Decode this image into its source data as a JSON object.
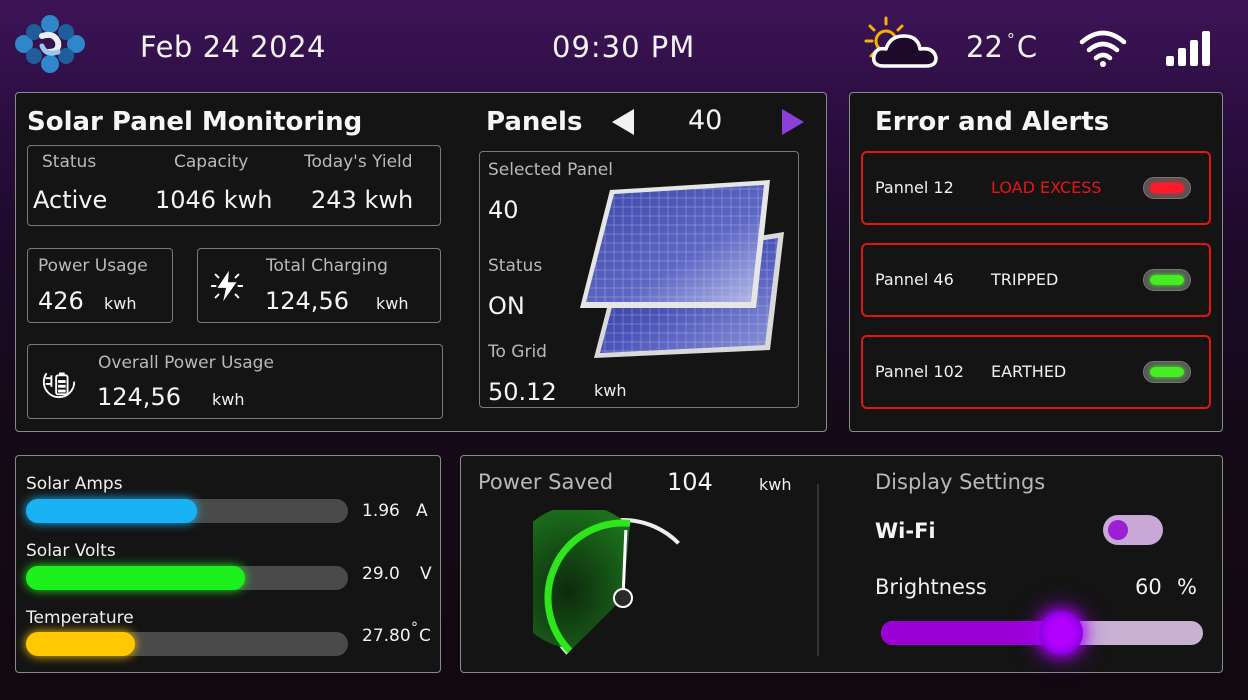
{
  "header": {
    "date": "Feb 24 2024",
    "time": "09:30  PM",
    "temperature": "22",
    "temperature_unit": "C",
    "icons": [
      "logo-icon",
      "partly-sunny-icon",
      "wifi-icon",
      "signal-icon"
    ]
  },
  "monitoring": {
    "title": "Solar Panel Monitoring",
    "status_label": "Status",
    "status_value": "Active",
    "capacity_label": "Capacity",
    "capacity_value": "1046 kwh",
    "yield_label": "Today's Yield",
    "yield_value": "243 kwh",
    "power_usage_label": "Power Usage",
    "power_usage_value": "426",
    "power_usage_unit": "kwh",
    "total_charging_label": "Total Charging",
    "total_charging_value": "124,56",
    "total_charging_unit": "kwh",
    "overall_label": "Overall Power Usage",
    "overall_value": "124,56",
    "overall_unit": "kwh"
  },
  "panels": {
    "title": "Panels",
    "count": "40",
    "selected_label": "Selected Panel",
    "selected_value": "40",
    "status_label": "Status",
    "status_value": "ON",
    "grid_label": "To Grid",
    "grid_value": "50.12",
    "grid_unit": "kwh"
  },
  "alerts": {
    "title": "Error and Alerts",
    "items": [
      {
        "name": "Pannel 12",
        "message": "LOAD EXCESS",
        "status_color": "#ff1a2a"
      },
      {
        "name": "Pannel 46",
        "message": "TRIPPED",
        "status_color": "#44ee22"
      },
      {
        "name": "Pannel 102",
        "message": "EARTHED",
        "status_color": "#44ee22"
      }
    ]
  },
  "meters": [
    {
      "label": "Solar Amps",
      "value": "1.96",
      "unit": "A",
      "fraction": 0.53,
      "color": "#19b3f5"
    },
    {
      "label": "Solar Volts",
      "value": "29.0",
      "unit": "V",
      "fraction": 0.68,
      "color": "#1ef01e"
    },
    {
      "label": "Temperature",
      "value": "27.80",
      "unit": "C",
      "fraction": 0.34,
      "color": "#ffc800"
    }
  ],
  "power_saved": {
    "label": "Power Saved",
    "value": "104",
    "unit": "kwh",
    "gauge_fraction": 0.86
  },
  "display_settings": {
    "title": "Display Settings",
    "wifi_label": "Wi-Fi",
    "wifi_on": true,
    "brightness_label": "Brightness",
    "brightness_value": "60",
    "brightness_unit": "%",
    "brightness_fraction": 0.56
  },
  "colors": {
    "accent": "#a200ff",
    "alert_red": "#e21414",
    "arrow_purple": "#8b3fd8"
  }
}
